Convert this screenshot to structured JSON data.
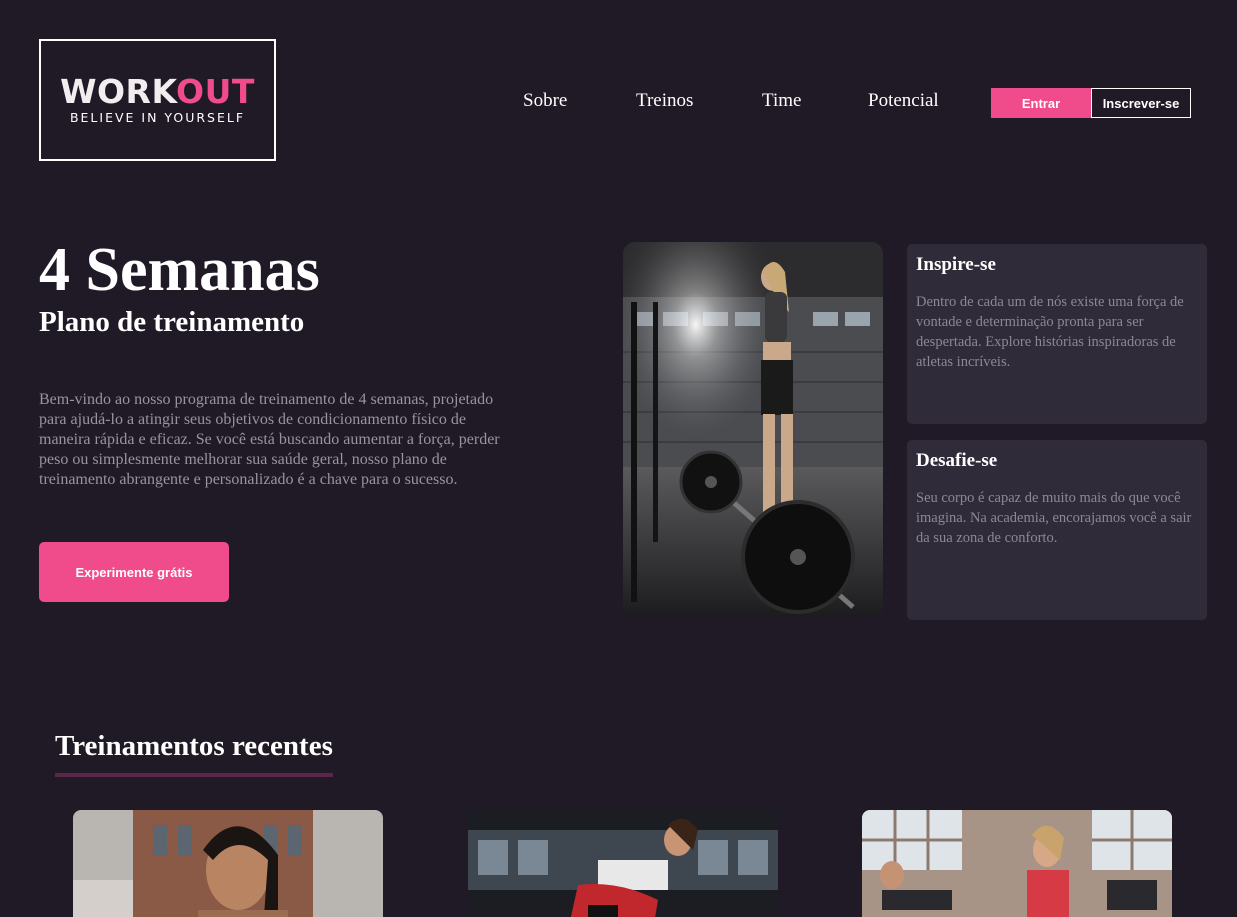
{
  "logo": {
    "word_a": "WORK",
    "word_b": "OUT",
    "tagline": "BELIEVE IN YOURSELF"
  },
  "nav": {
    "items": [
      "Sobre",
      "Treinos",
      "Time",
      "Potencial"
    ]
  },
  "auth": {
    "login_label": "Entrar",
    "signup_label": "Inscrever-se"
  },
  "hero": {
    "title": "4 Semanas",
    "subtitle": "Plano de treinamento",
    "description": "Bem-vindo ao nosso programa de treinamento de 4 semanas, projetado para ajudá-lo a atingir seus objetivos de condicionamento físico de maneira rápida e eficaz. Se você está buscando aumentar a força, perder peso ou simplesmente melhorar sua saúde geral, nosso plano de treinamento abrangente e personalizado é a chave para o sucesso.",
    "cta_label": "Experimente grátis"
  },
  "cards": [
    {
      "title": "Inspire-se",
      "text": "Dentro de cada um de nós existe uma força de vontade e determinação pronta para ser despertada. Explore histórias inspiradoras de atletas incríveis."
    },
    {
      "title": "Desafie-se",
      "text": "Seu corpo é capaz de muito mais do que você imagina. Na academia, encorajamos você a sair da sua zona de conforto."
    }
  ],
  "recent": {
    "title": "Treinamentos recentes"
  },
  "colors": {
    "background": "#1f1a25",
    "accent": "#f04b8a",
    "card": "#302b38",
    "underline": "#5a2748"
  }
}
